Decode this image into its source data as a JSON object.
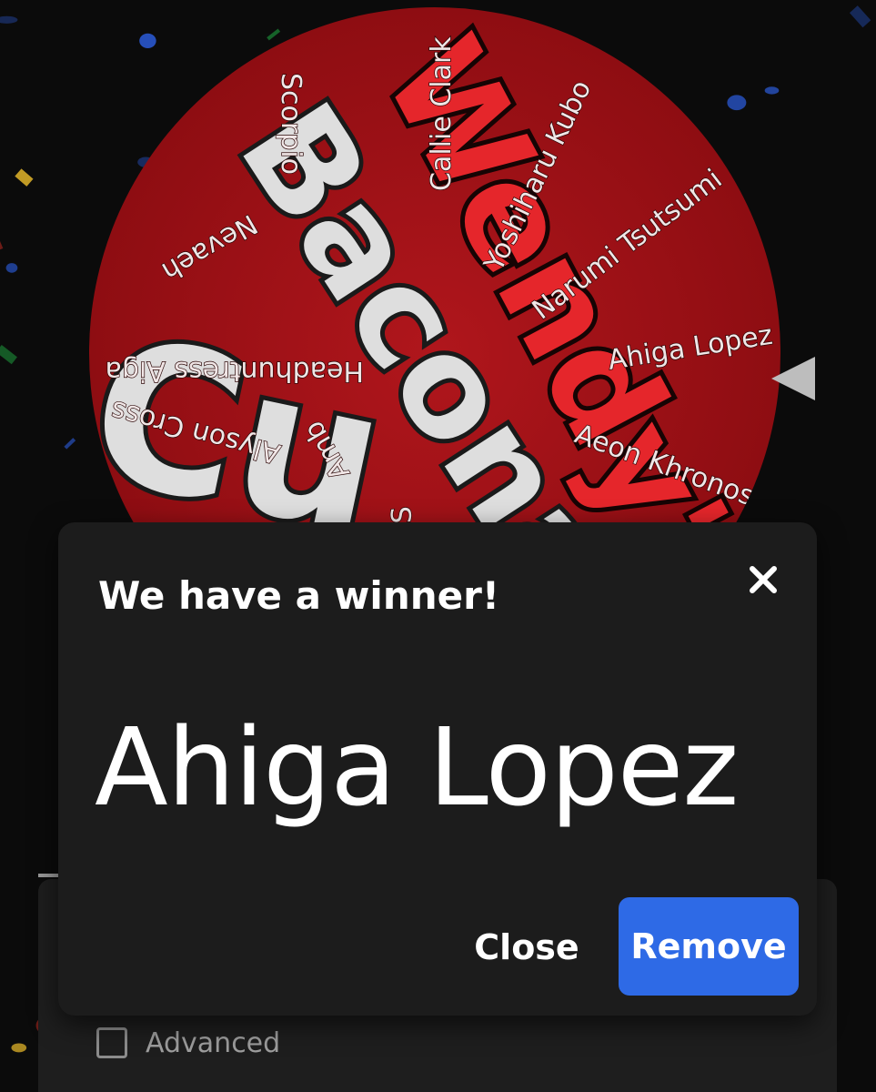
{
  "wheel": {
    "names": [
      "Callie Clark",
      "Yoshiharu Kubo",
      "Narumi Tsutsumi",
      "Ahiga Lopez",
      "Aeon Khronos",
      "Scorpio",
      "Nevaeh",
      "Headhuntress Aiga",
      "Alyson Cross",
      "Amb",
      "S"
    ],
    "background_text_white": "Bacona",
    "background_text_red": "Wendy's",
    "background_text_bottom": "Cu",
    "colors": {
      "wheel_fill": "#a8141a",
      "wheel_dark": "#7a0a0e",
      "pointer": "#bdbdbd"
    }
  },
  "dialog": {
    "title": "We have a winner!",
    "winner": "Ahiga Lopez",
    "close_label": "Close",
    "remove_label": "Remove",
    "close_icon": "close-icon"
  },
  "settings_panel": {
    "advanced_label": "Advanced",
    "advanced_checked": false
  },
  "colors": {
    "background": "#0b0b0b",
    "dialog_bg": "#1c1c1c",
    "accent": "#2e6ae6",
    "confetti": [
      "#2b5bd7",
      "#1e9a3c",
      "#e2b52a",
      "#d93025"
    ]
  }
}
